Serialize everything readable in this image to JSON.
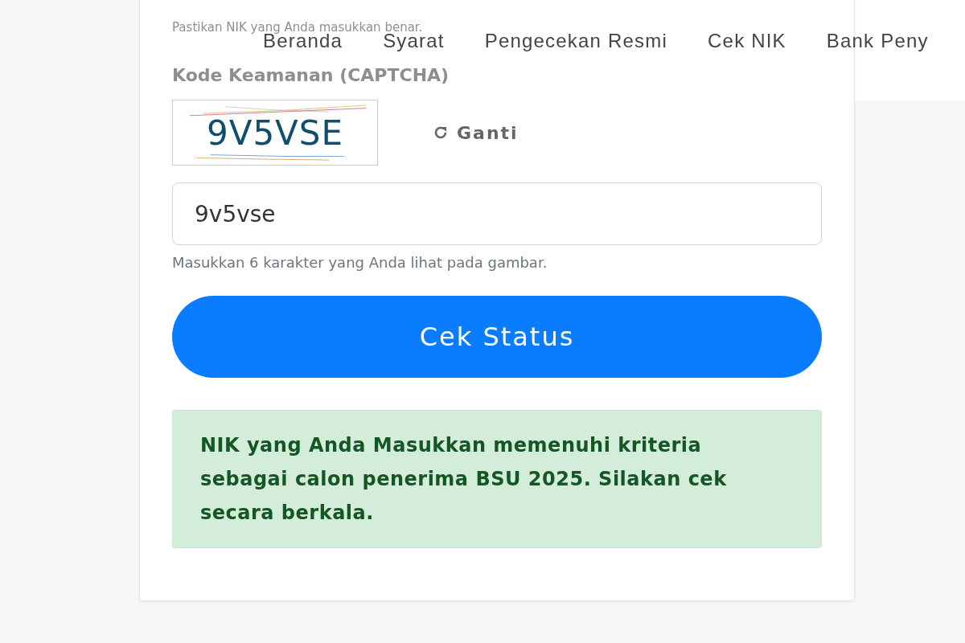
{
  "nav": {
    "items": [
      {
        "label": "Beranda"
      },
      {
        "label": "Syarat"
      },
      {
        "label": "Pengecekan Resmi"
      },
      {
        "label": "Cek NIK"
      },
      {
        "label": "Bank Peny"
      }
    ]
  },
  "form": {
    "nik_hint": "Pastikan NIK yang Anda masukkan benar.",
    "captcha_label": "Kode Keamanan (CAPTCHA)",
    "captcha_text": "9V5VSE",
    "refresh_label": "Ganti",
    "captcha_value": "9v5vse",
    "captcha_hint": "Masukkan 6 karakter yang Anda lihat pada gambar.",
    "submit": "Cek Status"
  },
  "alert": {
    "kind": "success",
    "message": "NIK yang Anda Masukkan memenuhi kriteria sebagai calon penerima BSU 2025. Silakan cek secara berkala."
  }
}
